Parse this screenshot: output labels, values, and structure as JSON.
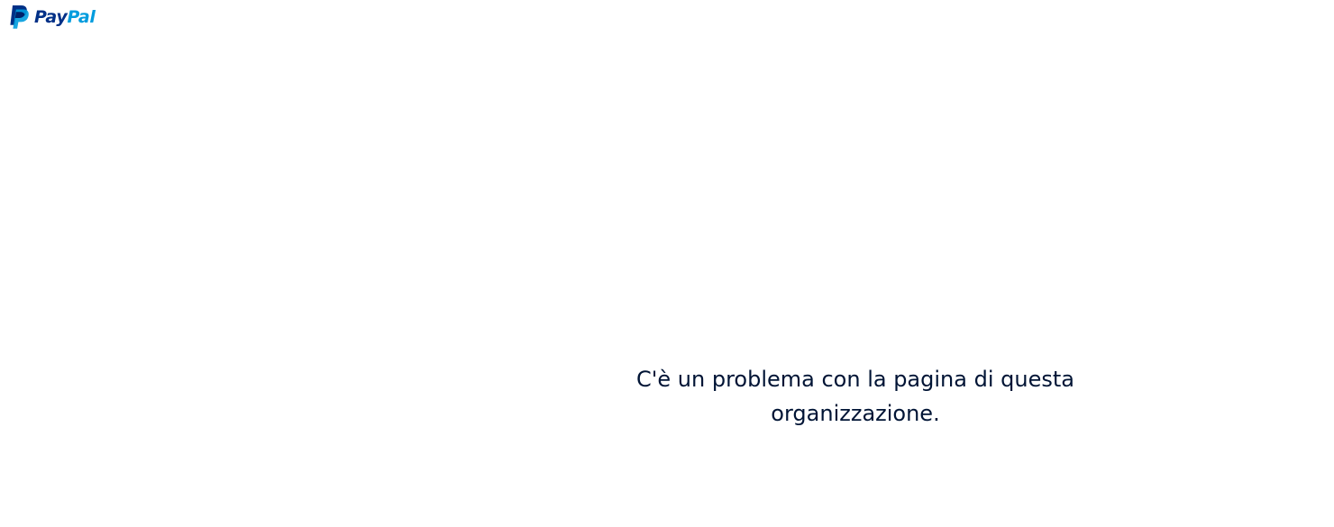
{
  "header": {
    "logo": {
      "icon": "paypal-logo-icon",
      "word_part1": "Pay",
      "word_part2": "Pal",
      "color_dark": "#003087",
      "color_light": "#009cde"
    }
  },
  "main": {
    "error_message": "C'è un problema con la pagina di questa organizzazione.",
    "text_color": "#001435"
  }
}
